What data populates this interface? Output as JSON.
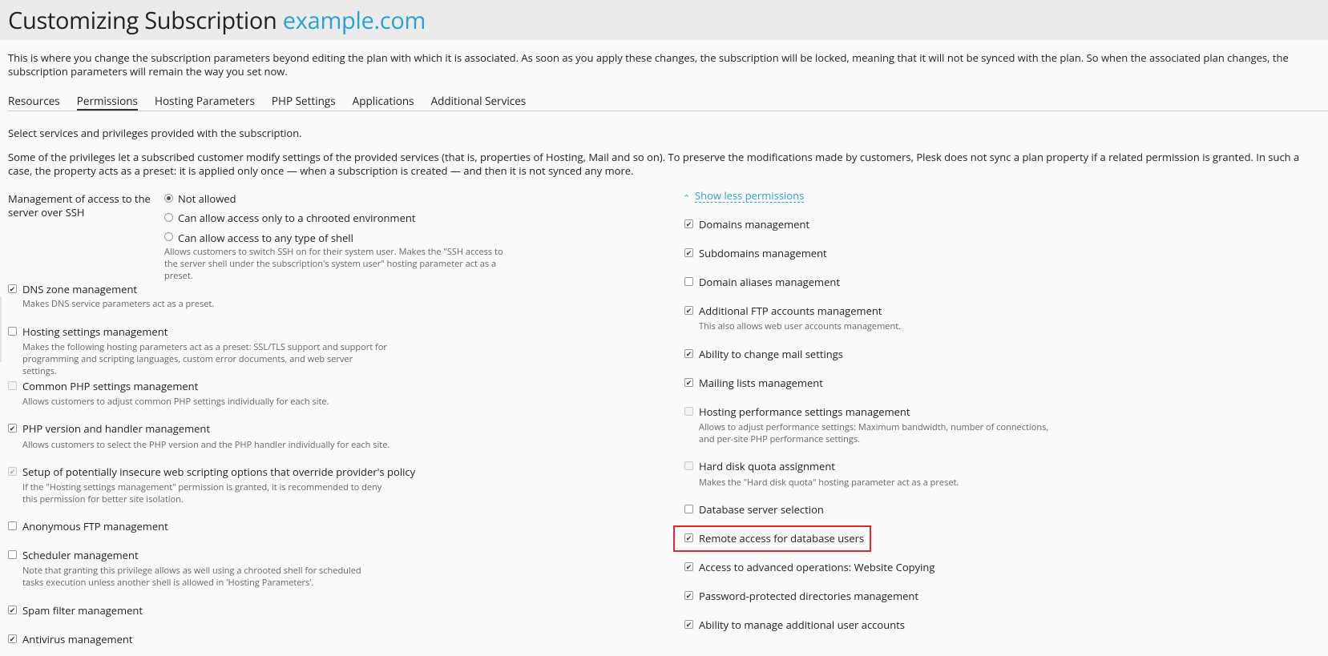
{
  "header": {
    "title": "Customizing Subscription",
    "domain": "example.com"
  },
  "intro": "This is where you change the subscription parameters beyond editing the plan with which it is associated. As soon as you apply these changes, the subscription will be locked, meaning that it will not be synced with the plan. So when the associated plan changes, the subscription parameters will remain the way you set now.",
  "tabs": [
    "Resources",
    "Permissions",
    "Hosting Parameters",
    "PHP Settings",
    "Applications",
    "Additional Services"
  ],
  "lead1": "Select services and privileges provided with the subscription.",
  "lead2": "Some of the privileges let a subscribed customer modify settings of the provided services (that is, properties of Hosting, Mail and so on). To preserve the modifications made by customers, Plesk does not sync a plan property if a related permission is granted. In such a case, the property acts as a preset: it is applied only once — when a subscription is created — and then it is not synced any more.",
  "ssh": {
    "label": "Management of access to the server over SSH",
    "options": [
      "Not allowed",
      "Can allow access only to a chrooted environment",
      "Can allow access to any type of shell"
    ],
    "hint": "Allows customers to switch SSH on for their system user. Makes the \"SSH access to the server shell under the subscription's system user\" hosting parameter act as a preset."
  },
  "left": [
    {
      "label": "DNS zone management",
      "hint": "Makes DNS service parameters act as a preset."
    },
    {
      "label": "Hosting settings management",
      "hint": "Makes the following hosting parameters act as a preset: SSL/TLS support and support for programming and scripting languages, custom error documents, and web server settings."
    },
    {
      "label": "Common PHP settings management",
      "hint": "Allows customers to adjust common PHP settings individually for each site."
    },
    {
      "label": "PHP version and handler management",
      "hint": "Allows customers to select the PHP version and the PHP handler individually for each site."
    },
    {
      "label": "Setup of potentially insecure web scripting options that override provider's policy",
      "hint": "If the \"Hosting settings management\" permission is granted, it is recommended to deny this permission for better site isolation."
    },
    {
      "label": "Anonymous FTP management",
      "hint": ""
    },
    {
      "label": "Scheduler management",
      "hint": "Note that granting this privilege allows as well using a chrooted shell for scheduled tasks execution unless another shell is allowed in 'Hosting Parameters'."
    },
    {
      "label": "Spam filter management",
      "hint": ""
    },
    {
      "label": "Antivirus management",
      "hint": ""
    }
  ],
  "show_less": "Show less permissions",
  "right": [
    {
      "label": "Domains management",
      "hint": ""
    },
    {
      "label": "Subdomains management",
      "hint": ""
    },
    {
      "label": "Domain aliases management",
      "hint": ""
    },
    {
      "label": "Additional FTP accounts management",
      "hint": "This also allows web user accounts management."
    },
    {
      "label": "Ability to change mail settings",
      "hint": ""
    },
    {
      "label": "Mailing lists management",
      "hint": ""
    },
    {
      "label": "Hosting performance settings management",
      "hint": "Allows to adjust performance settings: Maximum bandwidth, number of connections, and per-site PHP performance settings."
    },
    {
      "label": "Hard disk quota assignment",
      "hint": "Makes the \"Hard disk quota\" hosting parameter act as a preset."
    },
    {
      "label": "Database server selection",
      "hint": ""
    },
    {
      "label": "Remote access for database users",
      "hint": ""
    },
    {
      "label": "Access to advanced operations: Website Copying",
      "hint": ""
    },
    {
      "label": "Password-protected directories management",
      "hint": ""
    },
    {
      "label": "Ability to manage additional user accounts",
      "hint": ""
    }
  ]
}
